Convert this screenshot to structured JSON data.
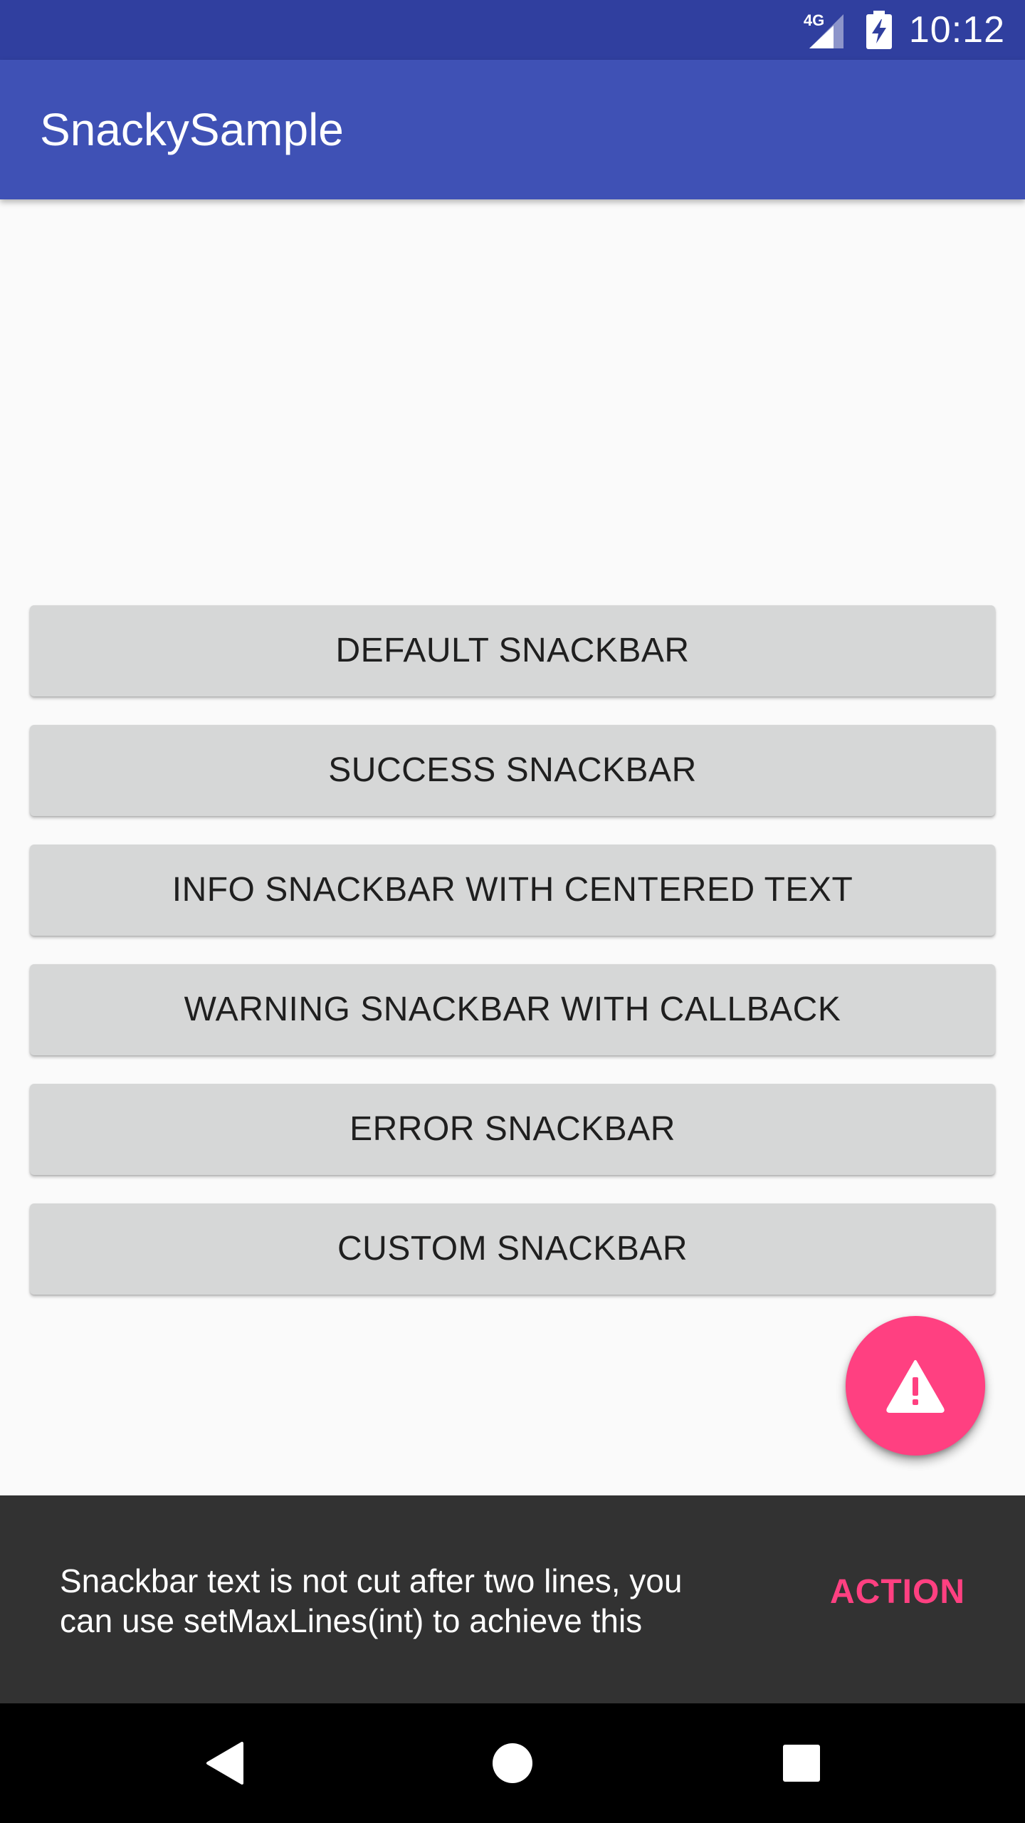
{
  "status_bar": {
    "network_label": "4G",
    "time": "10:12"
  },
  "app_bar": {
    "title": "SnackySample"
  },
  "buttons": [
    {
      "label": "DEFAULT SNACKBAR"
    },
    {
      "label": "SUCCESS SNACKBAR"
    },
    {
      "label": "INFO SNACKBAR WITH CENTERED TEXT"
    },
    {
      "label": "WARNING SNACKBAR WITH CALLBACK"
    },
    {
      "label": "ERROR SNACKBAR"
    },
    {
      "label": "CUSTOM SNACKBAR"
    }
  ],
  "fab": {
    "icon": "warning-icon"
  },
  "snackbar": {
    "message_line1": "Snackbar text is not cut after two lines, you",
    "message_line2": "can use setMaxLines(int) to achieve this",
    "action_label": "ACTION"
  },
  "nav_bar": {
    "back_icon": "back-triangle-icon",
    "home_icon": "home-circle-icon",
    "recents_icon": "recents-square-icon"
  },
  "colors": {
    "primary": "#3f51b5",
    "primary_dark": "#303f9f",
    "accent": "#ff4081",
    "background": "#fafafa",
    "button": "#d6d7d7",
    "snackbar": "#323232"
  }
}
